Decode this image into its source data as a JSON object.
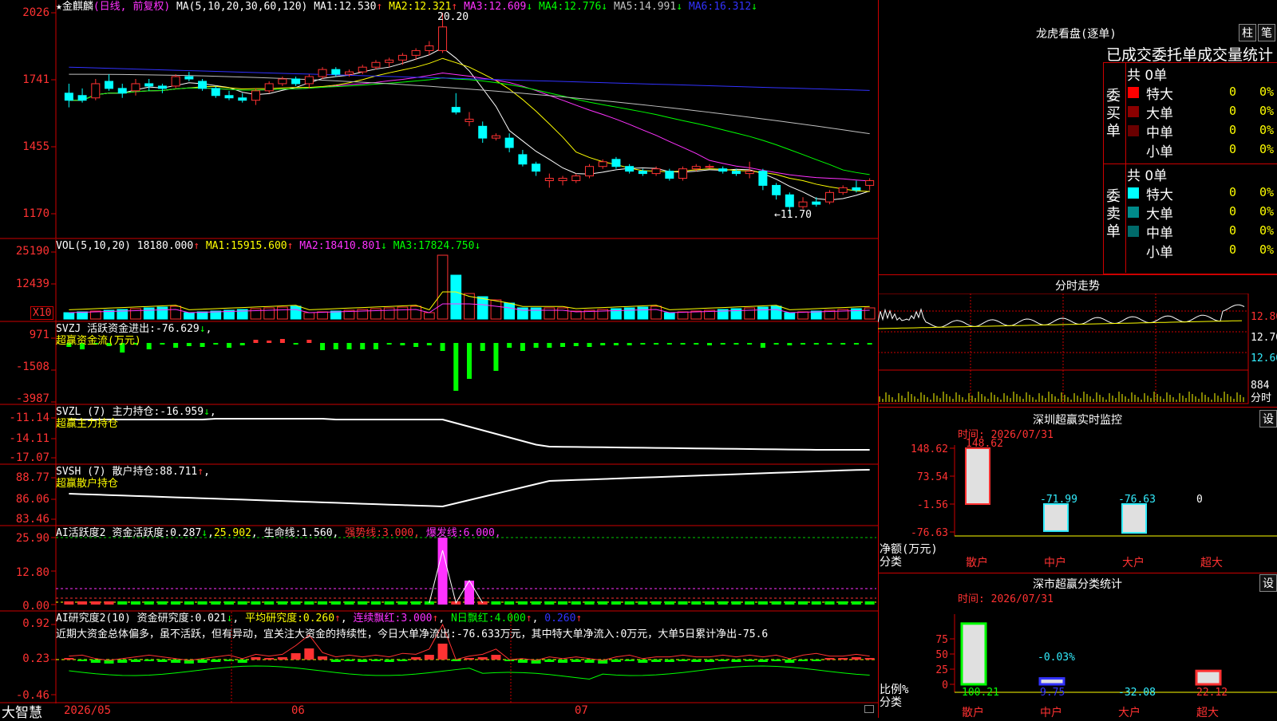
{
  "colors": {
    "up": "#ff3232",
    "down": "#00ffff",
    "frame": "#cc0000",
    "ma1": "#ffffff",
    "ma2": "#ffff00",
    "ma3": "#ff32ff",
    "ma4": "#00ff00",
    "ma5": "#c0c0c0",
    "ma6": "#3232ff"
  },
  "main": {
    "title_star": "★",
    "stock_name": "金麒麟",
    "period": "(日线, 前复权)",
    "ma_params": "MA(5,10,20,30,60,120)",
    "ma": [
      {
        "label": "MA1:",
        "value": "12.530",
        "arrow": "↑"
      },
      {
        "label": "MA2:",
        "value": "12.321",
        "arrow": "↑"
      },
      {
        "label": "MA3:",
        "value": "12.609",
        "arrow": "↓"
      },
      {
        "label": "MA4:",
        "value": "12.776",
        "arrow": "↓"
      },
      {
        "label": "MA5:",
        "value": "14.991",
        "arrow": "↓"
      },
      {
        "label": "MA6:",
        "value": "16.312",
        "arrow": "↓"
      }
    ],
    "y_ticks": [
      "2026",
      "1741",
      "1455",
      "1170"
    ],
    "high_mark": "20.20",
    "low_mark": "←11.70"
  },
  "vol": {
    "params": "VOL(5,10,20)",
    "value": "18180.000",
    "arrow": "↑",
    "ma": [
      {
        "label": "MA1:",
        "value": "15915.600",
        "arrow": "↑"
      },
      {
        "label": "MA2:",
        "value": "18410.801",
        "arrow": "↓"
      },
      {
        "label": "MA3:",
        "value": "17824.750",
        "arrow": "↓"
      }
    ],
    "y_ticks": [
      "25190",
      "12439"
    ],
    "unit": "X10"
  },
  "svzj": {
    "label": "SVZJ",
    "desc": "活跃资金进出:",
    "value": "-76.629",
    "arrow": "↓",
    "tail": ",",
    "sub": "超赢资金流(万元)",
    "y_ticks": [
      "971",
      "-1508",
      "-3987"
    ]
  },
  "svzl": {
    "label": "SVZL (7)",
    "desc": "主力持仓:",
    "value": "-16.959",
    "arrow": "↓",
    "tail": ",",
    "sub": "超赢主力持仓",
    "y_ticks": [
      "-11.14",
      "-14.11",
      "-17.07"
    ]
  },
  "svsh": {
    "label": "SVSH (7)",
    "desc": "散户持仓:",
    "value": "88.711",
    "arrow": "↑",
    "tail": ",",
    "sub": "超赢散户持仓",
    "y_ticks": [
      "88.77",
      "86.06",
      "83.46"
    ]
  },
  "ai1": {
    "label": "AI活跃度2",
    "desc": "资金活跃度:",
    "value": "0.287",
    "arrow": "↓",
    "v2": "25.902",
    "d3": "生命线:",
    "v3": "1.560",
    "d4": "强势线:",
    "v4": "3.000",
    "d5": "爆发线:",
    "v5": "6.000",
    "y_ticks": [
      "25.90",
      "12.80",
      "0.00"
    ]
  },
  "ai2": {
    "label": "AI研究度2(10)",
    "d1": "资金研究度:",
    "v1": "0.021",
    "a1": "↓",
    "d2": "平均研究度:",
    "v2": "0.260",
    "a2": "↑",
    "d3": "连续飘红:",
    "v3": "3.000",
    "a3": "↑",
    "d4": "N日飘红:",
    "v4": "4.000",
    "a4": "↑",
    "v5": "0.260",
    "a5": "↑",
    "text": "近期大资金总体偏多，虽不活跃，但有异动，宜关注大资金的持续性，今日大单净流出:-76.633万元，其中特大单净流入:0万元，大单5日累计净出-75.6",
    "y_ticks": [
      "0.92",
      "0.23",
      "-0.46"
    ]
  },
  "bottom": {
    "logo": "大智慧",
    "dates": [
      "2026/05",
      "06",
      "07"
    ]
  },
  "right": {
    "dragon_title": "龙虎看盘(逐单)",
    "btn1": "柱",
    "btn2": "笔",
    "stat_title": "已成交委托单成交量统计",
    "buy_label": "委买单",
    "buy_total": "共 0单",
    "sell_label": "委卖单",
    "sell_total": "共 0单",
    "rows": [
      {
        "name": "特大",
        "count": "0",
        "pct": "0%"
      },
      {
        "name": "大单",
        "count": "0",
        "pct": "0%"
      },
      {
        "name": "中单",
        "count": "0",
        "pct": "0%"
      },
      {
        "name": "小单",
        "count": "0",
        "pct": "0%"
      }
    ],
    "buy_colors": [
      "#ff0000",
      "#8b0000",
      "#6a0000",
      ""
    ],
    "sell_colors": [
      "#00ffff",
      "#008b8b",
      "#006a6a",
      ""
    ],
    "intraday_title": "分时走势",
    "intraday_prices": [
      "12.80",
      "12.70",
      "12.60"
    ],
    "intraday_vol": "884",
    "intraday_unit": "分时",
    "monitor": {
      "title": "深圳超赢实时监控",
      "btn": "设",
      "time": "时间: 2026/07/31",
      "y_ticks": [
        "148.62",
        "73.54",
        "-1.56",
        "-76.63"
      ],
      "ylabel": "净额(万元)",
      "xlabel": "分类",
      "bars": [
        {
          "name": "散户",
          "value": "148.62",
          "num": 148.62
        },
        {
          "name": "中户",
          "value": "-71.99",
          "num": -71.99
        },
        {
          "name": "大户",
          "value": "-76.63",
          "num": -76.63
        },
        {
          "name": "超大",
          "value": "0",
          "num": 0
        }
      ]
    },
    "classify": {
      "title": "深市超赢分类统计",
      "btn": "设",
      "time": "时间: 2026/07/31",
      "y_ticks": [
        "75",
        "50",
        "25",
        "0"
      ],
      "ylabel": "比例%",
      "xlabel": "分类",
      "bar_label": "-0.03%",
      "bars": [
        {
          "name": "散户",
          "value": "100.21",
          "num": 100.21
        },
        {
          "name": "中户",
          "value": "9.75",
          "num": 9.75
        },
        {
          "name": "大户",
          "value": "-32.08",
          "num": -32.08
        },
        {
          "name": "超大",
          "value": "22.12",
          "num": 22.12
        }
      ]
    }
  },
  "chart_data": {
    "type": "candlestick",
    "ylim": [
      11.7,
      20.2
    ],
    "ohlc": [
      [
        16.8,
        17.2,
        16.2,
        16.5
      ],
      [
        16.7,
        17.0,
        16.4,
        16.5
      ],
      [
        16.6,
        17.4,
        16.5,
        17.2
      ],
      [
        17.3,
        17.6,
        16.9,
        17.0
      ],
      [
        17.0,
        17.2,
        16.6,
        16.8
      ],
      [
        16.9,
        17.4,
        16.7,
        17.2
      ],
      [
        17.2,
        17.4,
        16.9,
        17.1
      ],
      [
        17.1,
        17.2,
        16.8,
        17.0
      ],
      [
        17.1,
        17.6,
        17.0,
        17.5
      ],
      [
        17.5,
        17.7,
        17.3,
        17.4
      ],
      [
        17.3,
        17.4,
        16.9,
        17.0
      ],
      [
        17.0,
        17.1,
        16.6,
        16.7
      ],
      [
        16.7,
        16.9,
        16.5,
        16.6
      ],
      [
        16.6,
        16.8,
        16.4,
        16.5
      ],
      [
        16.5,
        17.0,
        16.3,
        16.9
      ],
      [
        16.9,
        17.3,
        16.8,
        17.2
      ],
      [
        17.2,
        17.5,
        17.1,
        17.4
      ],
      [
        17.4,
        17.5,
        17.1,
        17.2
      ],
      [
        17.2,
        17.6,
        17.0,
        17.5
      ],
      [
        17.5,
        17.9,
        17.4,
        17.8
      ],
      [
        17.8,
        17.9,
        17.5,
        17.6
      ],
      [
        17.6,
        17.8,
        17.5,
        17.7
      ],
      [
        17.7,
        18.0,
        17.6,
        17.9
      ],
      [
        17.9,
        18.2,
        17.8,
        18.1
      ],
      [
        18.1,
        18.3,
        17.9,
        18.2
      ],
      [
        18.2,
        18.5,
        18.0,
        18.4
      ],
      [
        18.4,
        18.7,
        18.2,
        18.6
      ],
      [
        18.6,
        19.0,
        18.4,
        18.8
      ],
      [
        18.6,
        20.2,
        18.5,
        19.6
      ],
      [
        16.2,
        16.8,
        15.9,
        16.0
      ],
      [
        15.6,
        16.0,
        15.4,
        15.7
      ],
      [
        15.4,
        15.6,
        14.7,
        14.9
      ],
      [
        14.9,
        15.1,
        14.8,
        15.0
      ],
      [
        14.9,
        15.1,
        14.3,
        14.5
      ],
      [
        14.2,
        14.4,
        13.7,
        13.8
      ],
      [
        13.8,
        13.9,
        13.3,
        13.5
      ],
      [
        13.1,
        13.4,
        12.8,
        13.2
      ],
      [
        13.1,
        13.3,
        12.9,
        13.2
      ],
      [
        13.1,
        13.4,
        13.0,
        13.3
      ],
      [
        13.3,
        13.8,
        13.2,
        13.7
      ],
      [
        13.7,
        14.0,
        13.6,
        13.9
      ],
      [
        14.0,
        14.1,
        13.6,
        13.7
      ],
      [
        13.7,
        13.8,
        13.4,
        13.5
      ],
      [
        13.5,
        13.6,
        13.3,
        13.4
      ],
      [
        13.4,
        13.7,
        13.3,
        13.6
      ],
      [
        13.5,
        13.6,
        13.1,
        13.2
      ],
      [
        13.2,
        13.7,
        13.1,
        13.6
      ],
      [
        13.6,
        13.8,
        13.5,
        13.7
      ],
      [
        13.7,
        13.8,
        13.6,
        13.7
      ],
      [
        13.6,
        13.7,
        13.4,
        13.5
      ],
      [
        13.5,
        13.6,
        13.3,
        13.4
      ],
      [
        13.4,
        13.9,
        13.2,
        13.5
      ],
      [
        13.5,
        13.6,
        12.7,
        12.9
      ],
      [
        12.9,
        13.0,
        12.3,
        12.5
      ],
      [
        12.5,
        12.6,
        11.7,
        12.0
      ],
      [
        12.0,
        12.4,
        11.9,
        12.2
      ],
      [
        12.2,
        12.4,
        12.0,
        12.1
      ],
      [
        12.2,
        12.7,
        12.1,
        12.6
      ],
      [
        12.6,
        12.9,
        12.5,
        12.8
      ],
      [
        12.8,
        13.1,
        12.6,
        12.7
      ],
      [
        12.9,
        13.2,
        12.7,
        13.1
      ]
    ]
  }
}
